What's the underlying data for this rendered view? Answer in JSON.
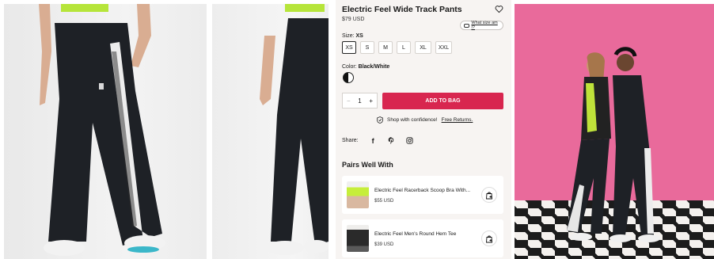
{
  "product": {
    "title": "Electric Feel Wide Track Pants",
    "price": "$79 USD",
    "size_guide_label": "What size am I?",
    "size_prefix": "Size:",
    "size_selected": "XS",
    "sizes": [
      "XS",
      "S",
      "M",
      "L",
      "XL",
      "XXL"
    ],
    "color_prefix": "Color:",
    "color_selected": "Black/White",
    "quantity": "1",
    "qty_minus": "−",
    "qty_plus": "+",
    "add_to_bag": "ADD TO BAG",
    "confidence_text": "Shop with confidence!",
    "free_returns": "Free Returns."
  },
  "share": {
    "label": "Share:",
    "icons": [
      "facebook-icon",
      "pinterest-icon",
      "instagram-icon"
    ]
  },
  "pairs": {
    "heading": "Pairs Well With",
    "items": [
      {
        "name": "Electric Feel Racerback Scoop Bra With...",
        "price": "$55 USD"
      },
      {
        "name": "Electric Feel Men's Round Hem Tee",
        "price": "$39 USD"
      }
    ]
  },
  "colors": {
    "accent": "#d8264f",
    "panel_bg": "#f7f4f2",
    "lifestyle_bg": "#e96a9b"
  }
}
